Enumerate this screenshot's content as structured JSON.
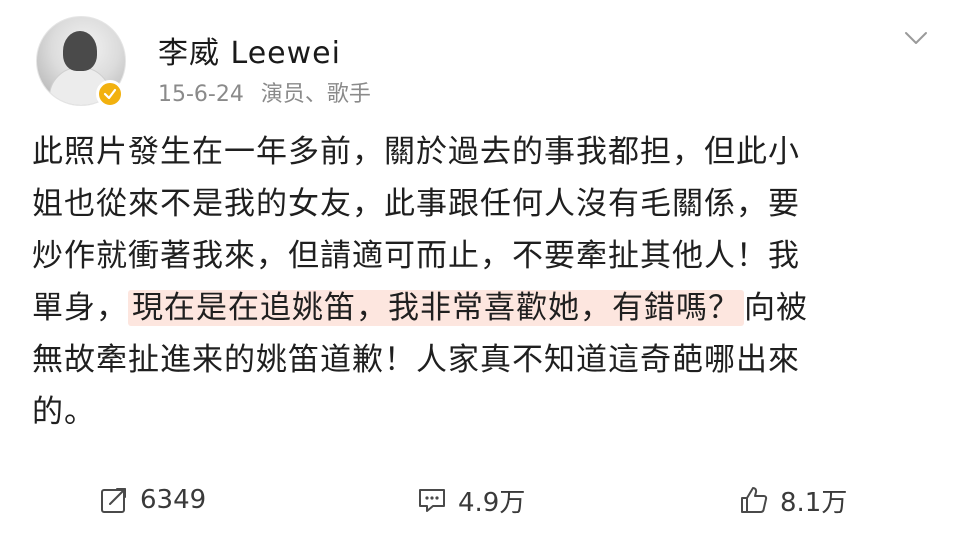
{
  "header": {
    "username": "李威 Leewei",
    "date": "15-6-24",
    "tags": "演员、歌手"
  },
  "post": {
    "line1": "此照片發生在一年多前，關於過去的事我都担，但此小",
    "line2": "姐也從來不是我的女友，此事跟任何人沒有毛關係，要",
    "line3": "炒作就衝著我來，但請適可而止，不要牽扯其他人！我",
    "line4_pre": "單身，",
    "line4_highlight": "現在是在追姚笛，我非常喜歡她，有錯嗎？",
    "line4_post": "向被",
    "line5": "無故牽扯進来的姚笛道歉！人家真不知道這奇葩哪出來",
    "line6": "的。"
  },
  "footer": {
    "repost_count": "6349",
    "comment_count": "4.9万",
    "like_count": "8.1万"
  },
  "icons": {
    "verified": "verified-badge-icon",
    "menu": "chevron-down-icon",
    "repost": "repost-icon",
    "comment": "comment-icon",
    "like": "thumbs-up-icon"
  },
  "colors": {
    "highlight": "#fde6df",
    "verified": "#f2b10f",
    "meta_text": "#8a8a8a"
  }
}
